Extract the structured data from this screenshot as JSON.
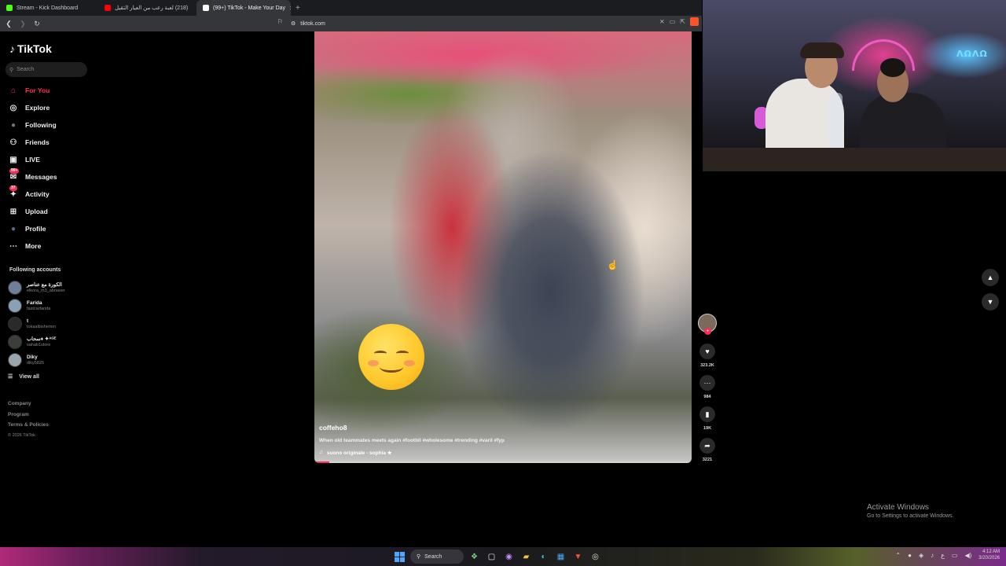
{
  "browser": {
    "tabs": [
      {
        "title": "Stream - Kick Dashboard",
        "favicon_color": "#53fc18"
      },
      {
        "title": "‏(218) لعبة رعب من العيار الثقيل",
        "favicon_color": "#ff0000"
      },
      {
        "title": "(99+) TikTok - Make Your Day",
        "favicon_color": "#ffffff",
        "active": true
      }
    ],
    "new_tab": "+",
    "close": "✕",
    "url": "tiktok.com"
  },
  "tiktok": {
    "logo": "TikTok",
    "search_placeholder": "Search",
    "nav": [
      {
        "label": "For You",
        "icon": "home-icon",
        "glyph": "⌂",
        "active": true
      },
      {
        "label": "Explore",
        "icon": "compass-icon",
        "glyph": "◎"
      },
      {
        "label": "Following",
        "icon": "following-avatar-icon",
        "glyph": "●"
      },
      {
        "label": "Friends",
        "icon": "friends-icon",
        "glyph": "⚇"
      },
      {
        "label": "LIVE",
        "icon": "live-icon",
        "glyph": "▣"
      },
      {
        "label": "Messages",
        "icon": "messages-icon",
        "glyph": "✉",
        "badge": "99+"
      },
      {
        "label": "Activity",
        "icon": "activity-icon",
        "glyph": "✦",
        "badge": "37"
      },
      {
        "label": "Upload",
        "icon": "upload-icon",
        "glyph": "⊞"
      },
      {
        "label": "Profile",
        "icon": "profile-icon",
        "glyph": "●"
      },
      {
        "label": "More",
        "icon": "more-icon",
        "glyph": "⋯"
      }
    ],
    "following_header": "Following accounts",
    "accounts": [
      {
        "name": "الكورة مع عناصر",
        "handle": "elkora_m3_abnaser"
      },
      {
        "name": "Farida",
        "handle": "fastcarfarida"
      },
      {
        "name": "t",
        "handle": "tokaalbishemm"
      },
      {
        "name": "سحاب♦ ✦ᴬᴳᴱ",
        "handle": "sahab1store"
      },
      {
        "name": "Diky",
        "handle": "diky5825"
      }
    ],
    "view_all": "View all",
    "footer": [
      "Company",
      "Program",
      "Terms & Policies"
    ],
    "copyright": "© 2026 TikTok"
  },
  "video": {
    "author": "coffeho8",
    "description": "When old teammates meets again #footbll #wholesome #trending #varil #fyp",
    "music": "suono originale - sophia ★",
    "progress": 0.04
  },
  "actions": {
    "likes": "323.2K",
    "comments": "984",
    "saves": "19K",
    "shares": "3221"
  },
  "webcam": {
    "sign_text": "ΛΩΛΩ"
  },
  "watermark": {
    "title": "Activate Windows",
    "subtitle": "Go to Settings to activate Windows."
  },
  "taskbar": {
    "search_label": "Search",
    "time": "4:12 AM",
    "date": "3/20/2026",
    "lang": "ع"
  }
}
